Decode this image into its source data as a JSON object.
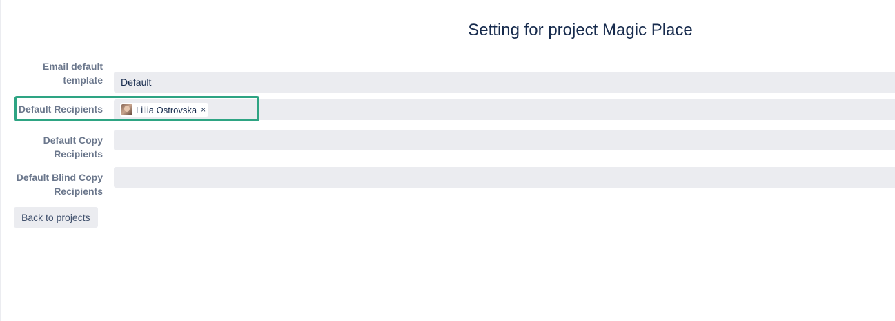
{
  "page": {
    "title": "Setting for project Magic Place"
  },
  "form": {
    "email_template": {
      "label_line1": "Email default",
      "label_line2": "template",
      "value": "Default"
    },
    "default_recipients": {
      "label": "Default Recipients",
      "tags": [
        {
          "name": "Liliia Ostrovska",
          "remove": "×"
        }
      ]
    },
    "default_copy_recipients": {
      "label_line1": "Default Copy",
      "label_line2": "Recipients",
      "value": ""
    },
    "default_blind_copy_recipients": {
      "label_line1": "Default Blind Copy",
      "label_line2": "Recipients",
      "value": ""
    }
  },
  "actions": {
    "back_label": "Back to projects"
  },
  "colors": {
    "highlight": "#2ea483",
    "field_bg": "#ebecf0",
    "title": "#172b4d",
    "label": "#6b778c"
  }
}
